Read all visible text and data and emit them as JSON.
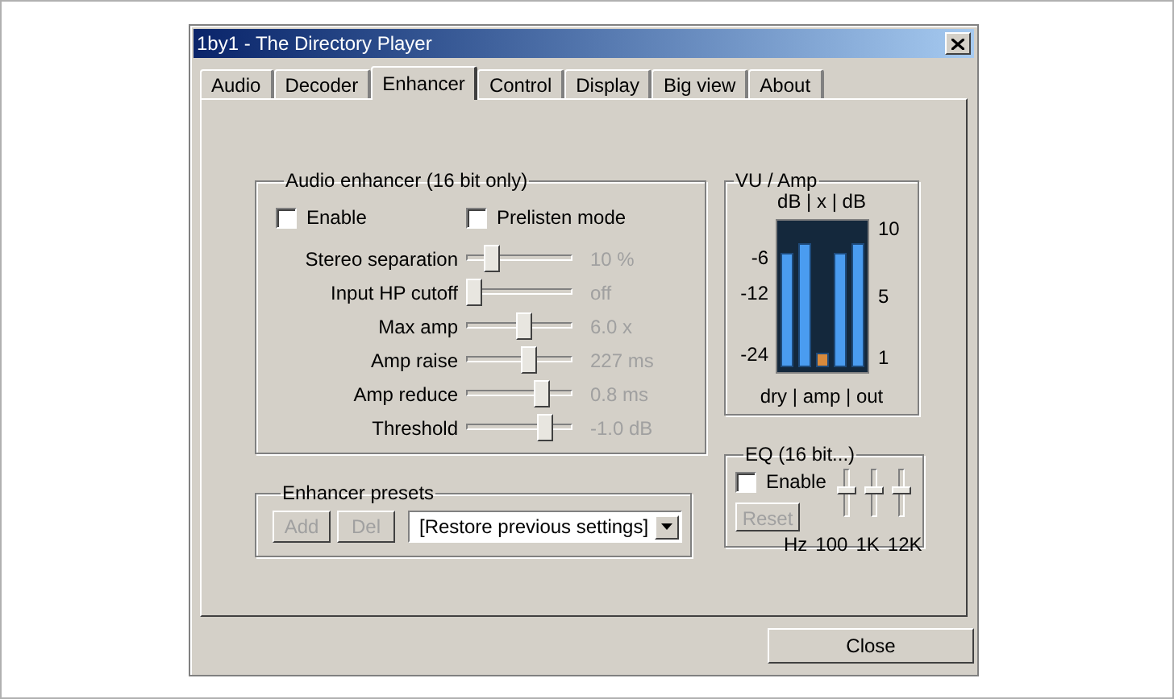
{
  "window": {
    "title": "1by1 - The Directory Player"
  },
  "tabs": [
    {
      "label": "Audio",
      "selected": false
    },
    {
      "label": "Decoder",
      "selected": false
    },
    {
      "label": "Enhancer",
      "selected": true
    },
    {
      "label": "Control",
      "selected": false
    },
    {
      "label": "Display",
      "selected": false
    },
    {
      "label": "Big view",
      "selected": false
    },
    {
      "label": "About",
      "selected": false
    }
  ],
  "audio_enhancer": {
    "title": "Audio enhancer (16 bit only)",
    "checkboxes": [
      {
        "label": "Enable",
        "checked": false
      },
      {
        "label": "Prelisten mode",
        "checked": false
      }
    ],
    "sliders": [
      {
        "label": "Stereo separation",
        "level": 0.2,
        "reading": "10 %"
      },
      {
        "label": "Input HP cutoff",
        "level": 0,
        "reading": "off"
      },
      {
        "label": "Max amp",
        "level": 0.55,
        "reading": "6.0 x"
      },
      {
        "label": "Amp raise",
        "level": 0.6,
        "reading": "227 ms"
      },
      {
        "label": "Amp reduce",
        "level": 0.75,
        "reading": "0.8 ms"
      },
      {
        "label": "Threshold",
        "level": 0.78,
        "reading": "-1.0 dB"
      }
    ]
  },
  "enhancer_presets": {
    "title": "Enhancer presets",
    "buttons": [
      {
        "label": "Add",
        "disabled": true
      },
      {
        "label": "Del",
        "disabled": true
      }
    ],
    "dropdown": {
      "value": "[Restore previous settings]"
    }
  },
  "vu_amp": {
    "title": "VU / Amp",
    "header": "dB | x | dB",
    "left_scale": [
      "-6",
      "-12",
      "-24"
    ],
    "right_scale": [
      "10",
      "5",
      "1"
    ],
    "meters": [
      {
        "level": 0.82,
        "color": "#4a9cf0"
      },
      {
        "level": 0.9,
        "color": "#4a9cf0"
      },
      {
        "level": 0.1,
        "color": "#d88a3c"
      },
      {
        "level": 0.82,
        "color": "#4a9cf0"
      },
      {
        "level": 0.9,
        "color": "#4a9cf0"
      }
    ],
    "footer": "dry | amp | out"
  },
  "eq": {
    "title": "EQ (16 bit...)",
    "enable": {
      "label": "Enable",
      "checked": false
    },
    "reset": {
      "label": "Reset",
      "disabled": true
    },
    "sliders": [
      {
        "level": 0.55
      },
      {
        "level": 0.55
      },
      {
        "level": 0.55
      }
    ],
    "labels": [
      "Hz",
      "100",
      "1K",
      "12K"
    ]
  },
  "buttons": [
    {
      "label": "Close"
    }
  ]
}
